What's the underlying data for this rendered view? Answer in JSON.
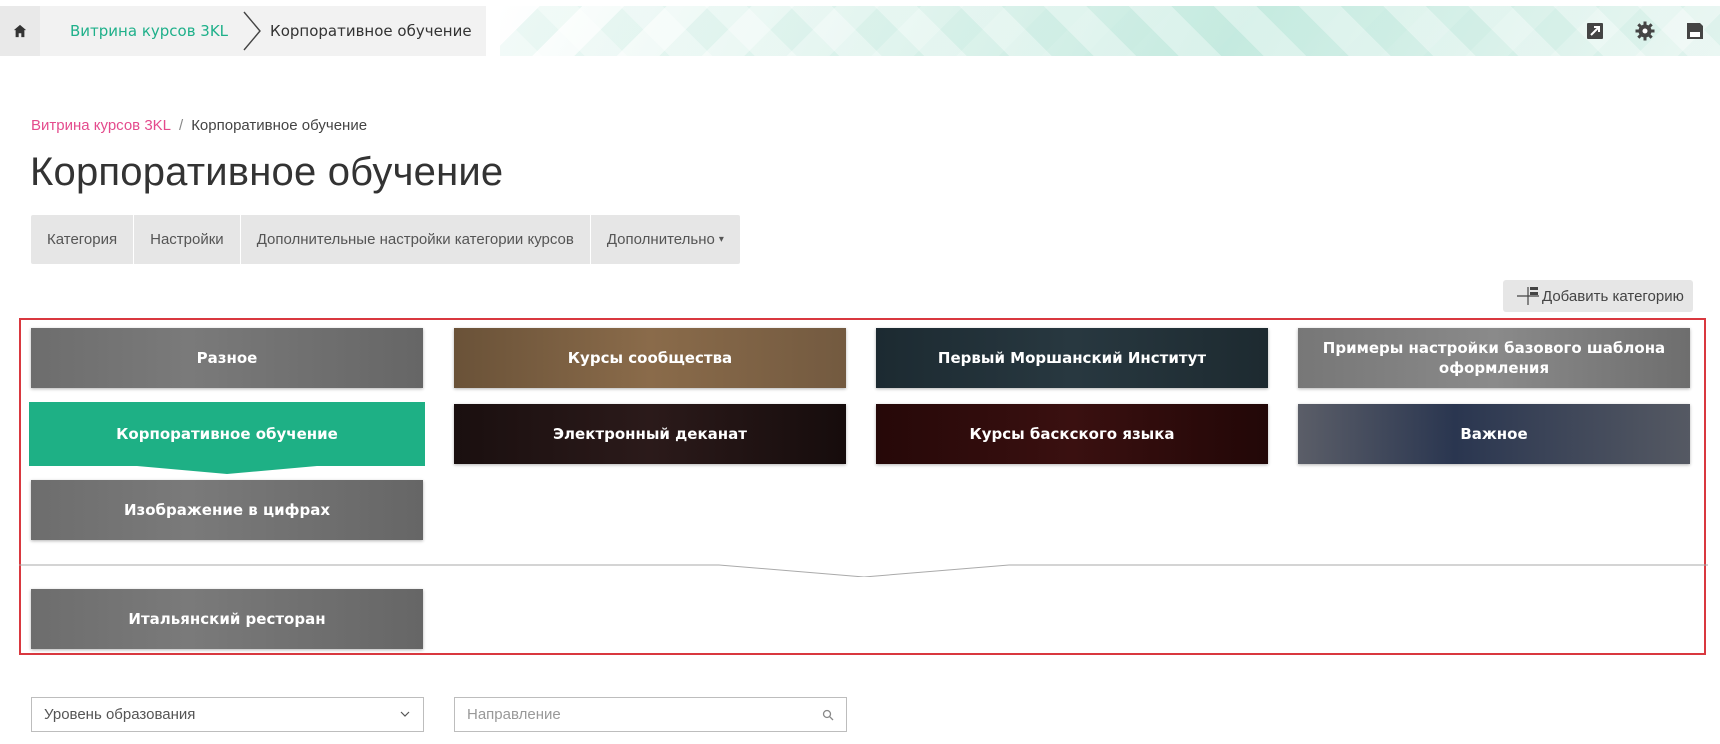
{
  "topbar": {
    "crumb_parent": "Витрина курсов 3KL",
    "crumb_current": "Корпоративное обучение",
    "icons": [
      "home-icon",
      "send-icon",
      "gear-icon",
      "save-icon"
    ]
  },
  "breadcrumb": {
    "parent": "Витрина курсов 3KL",
    "separator": "/",
    "current": "Корпоративное обучение"
  },
  "page_title": "Корпоративное обучение",
  "tabs": [
    {
      "label": "Категория"
    },
    {
      "label": "Настройки"
    },
    {
      "label": "Дополнительные настройки категории курсов"
    },
    {
      "label": "Дополнительно"
    }
  ],
  "add_category": {
    "label": "Добавить категорию"
  },
  "categories": [
    {
      "label": "Разное"
    },
    {
      "label": "Курсы сообщества"
    },
    {
      "label": "Первый Моршанский Институт"
    },
    {
      "label": "Примеры настройки базового шаблона оформления"
    },
    {
      "label": "Корпоративное обучение",
      "active": true
    },
    {
      "label": "Электронный деканат"
    },
    {
      "label": "Курсы баскского языка"
    },
    {
      "label": "Важное"
    },
    {
      "label": "Изображение в цифрах"
    },
    {
      "label": "Итальянский ресторан"
    }
  ],
  "filters": {
    "level_select": "Уровень образования",
    "direction_placeholder": "Направление"
  },
  "colors": {
    "accent": "#1eb085",
    "link_pink": "#e44b8d",
    "frame_red": "#d9383f"
  }
}
